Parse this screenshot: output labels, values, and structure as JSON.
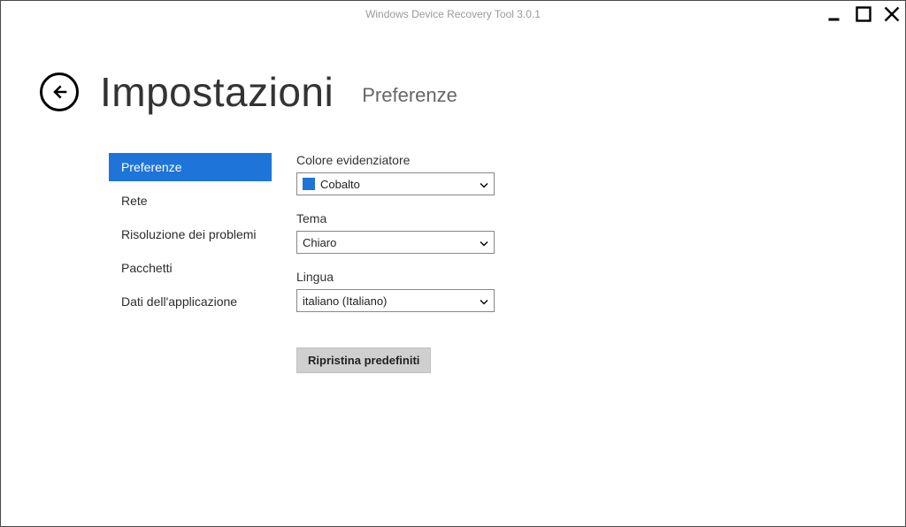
{
  "window": {
    "title": "Windows Device Recovery Tool 3.0.1"
  },
  "header": {
    "title": "Impostazioni",
    "subtitle": "Preferenze"
  },
  "sidebar": {
    "items": [
      {
        "label": "Preferenze",
        "active": true
      },
      {
        "label": "Rete",
        "active": false
      },
      {
        "label": "Risoluzione dei problemi",
        "active": false
      },
      {
        "label": "Pacchetti",
        "active": false
      },
      {
        "label": "Dati dell'applicazione",
        "active": false
      }
    ]
  },
  "preferences": {
    "highlight_color": {
      "label": "Colore evidenziatore",
      "value": "Cobalto",
      "swatch": "#1e74d8"
    },
    "theme": {
      "label": "Tema",
      "value": "Chiaro"
    },
    "language": {
      "label": "Lingua",
      "value": "italiano (Italiano)"
    },
    "reset_label": "Ripristina predefiniti"
  }
}
